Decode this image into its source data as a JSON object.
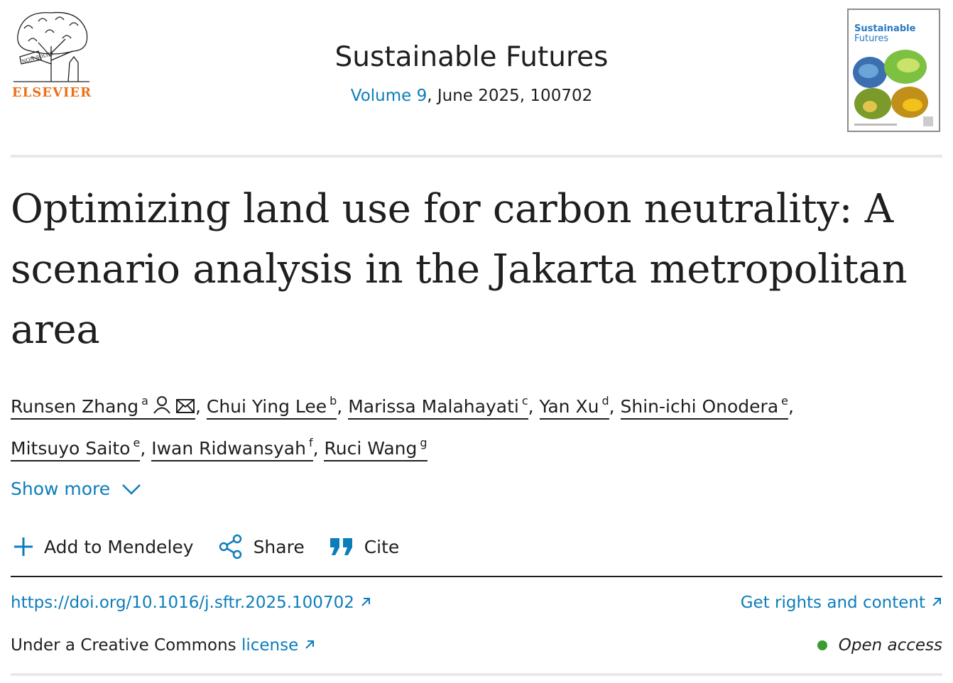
{
  "header": {
    "publisher_name": "ELSEVIER",
    "journal_title": "Sustainable Futures",
    "volume_label": "Volume 9",
    "issue_detail": ", June 2025, 100702",
    "cover": {
      "title_line1": "Sustainable",
      "title_line2": "Futures"
    }
  },
  "article": {
    "title": "Optimizing land use for carbon neutrality: A scenario analysis in the Jakarta metropolitan area"
  },
  "authors": [
    {
      "name": "Runsen Zhang",
      "affil": "a",
      "sep": ", "
    },
    {
      "name": "Chui Ying Lee",
      "affil": "b",
      "sep": ", "
    },
    {
      "name": "Marissa Malahayati",
      "affil": "c",
      "sep": ", "
    },
    {
      "name": "Yan Xu",
      "affil": "d",
      "sep": ", "
    },
    {
      "name": "Shin-ichi Onodera",
      "affil": "e",
      "sep": ","
    },
    {
      "name": "Mitsuyo Saito",
      "affil": "e",
      "sep": ", "
    },
    {
      "name": "Iwan Ridwansyah",
      "affil": "f",
      "sep": ", "
    },
    {
      "name": "Ruci Wang",
      "affil": "g",
      "sep": ""
    }
  ],
  "show_more": "Show more",
  "toolbar": {
    "mendeley": "Add to Mendeley",
    "share": "Share",
    "cite": "Cite"
  },
  "links": {
    "doi": "https://doi.org/10.1016/j.sftr.2025.100702",
    "rights": "Get rights and content",
    "license_prefix": "Under a Creative Commons ",
    "license": "license",
    "open_access": "Open access"
  },
  "colors": {
    "link": "#0c7dbb",
    "elsevier_orange": "#e9711c",
    "open_access_dot": "#3b9c2e"
  }
}
